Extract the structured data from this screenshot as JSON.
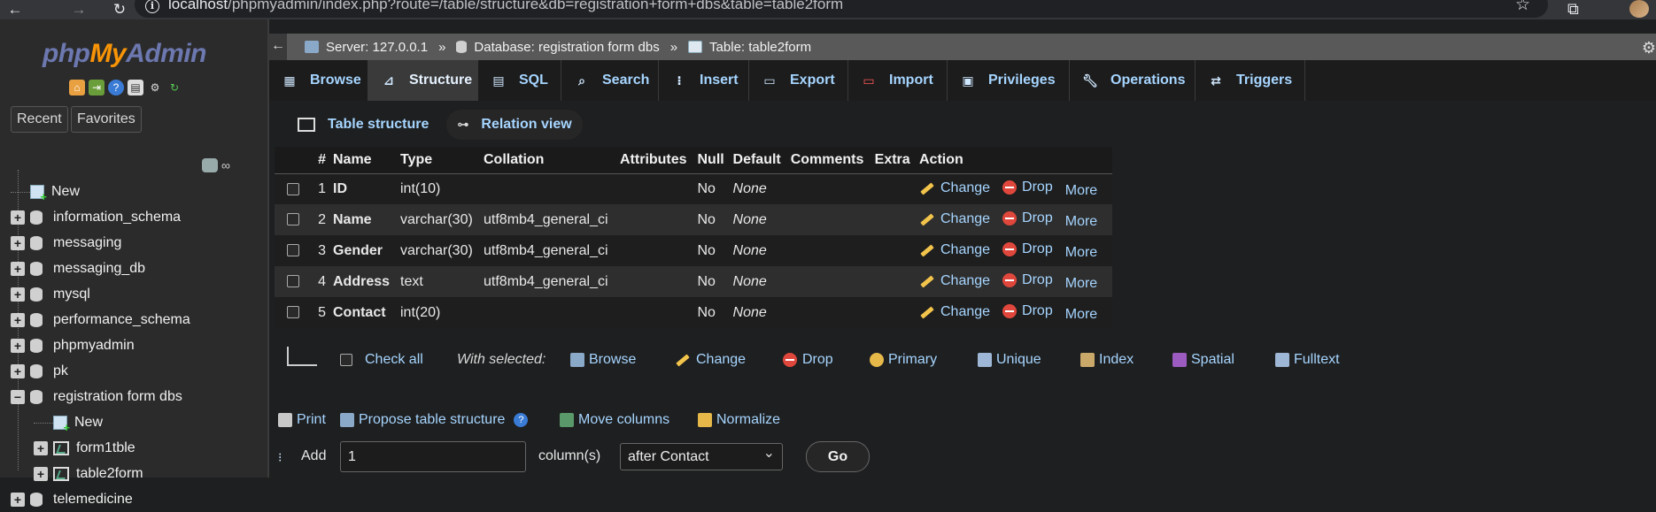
{
  "browser": {
    "url_host": "localhost",
    "url_path": "/phpmyadmin/index.php?route=/table/structure&db=registration+form+dbs&table=table2form"
  },
  "logo": {
    "php": "php",
    "my": "My",
    "admin": "Admin"
  },
  "nav": {
    "recent": "Recent",
    "favorites": "Favorites",
    "tree": [
      {
        "label": "New",
        "kind": "new",
        "level": 0
      },
      {
        "label": "information_schema",
        "kind": "db",
        "level": 0
      },
      {
        "label": "messaging",
        "kind": "db",
        "level": 0
      },
      {
        "label": "messaging_db",
        "kind": "db",
        "level": 0
      },
      {
        "label": "mysql",
        "kind": "db",
        "level": 0
      },
      {
        "label": "performance_schema",
        "kind": "db",
        "level": 0
      },
      {
        "label": "phpmyadmin",
        "kind": "db",
        "level": 0
      },
      {
        "label": "pk",
        "kind": "db",
        "level": 0
      },
      {
        "label": "registration form dbs",
        "kind": "db-open",
        "level": 0
      },
      {
        "label": "New",
        "kind": "new",
        "level": 1
      },
      {
        "label": "form1tble",
        "kind": "table",
        "level": 1
      },
      {
        "label": "table2form",
        "kind": "table",
        "level": 1
      },
      {
        "label": "telemedicine",
        "kind": "db",
        "level": 0
      }
    ]
  },
  "breadcrumb": {
    "server": "Server: 127.0.0.1",
    "database": "Database: registration form dbs",
    "table": "Table: table2form",
    "sep": "»"
  },
  "tabs": [
    "Browse",
    "Structure",
    "SQL",
    "Search",
    "Insert",
    "Export",
    "Import",
    "Privileges",
    "Operations",
    "Triggers"
  ],
  "active_tab": "Structure",
  "subtabs": {
    "table_structure": "Table structure",
    "relation_view": "Relation view"
  },
  "table": {
    "headers": [
      "#",
      "Name",
      "Type",
      "Collation",
      "Attributes",
      "Null",
      "Default",
      "Comments",
      "Extra",
      "Action"
    ],
    "rows": [
      {
        "num": "1",
        "name": "ID",
        "type": "int(10)",
        "collation": "",
        "null": "No",
        "default": "None"
      },
      {
        "num": "2",
        "name": "Name",
        "type": "varchar(30)",
        "collation": "utf8mb4_general_ci",
        "null": "No",
        "default": "None"
      },
      {
        "num": "3",
        "name": "Gender",
        "type": "varchar(30)",
        "collation": "utf8mb4_general_ci",
        "null": "No",
        "default": "None"
      },
      {
        "num": "4",
        "name": "Address",
        "type": "text",
        "collation": "utf8mb4_general_ci",
        "null": "No",
        "default": "None"
      },
      {
        "num": "5",
        "name": "Contact",
        "type": "int(20)",
        "collation": "",
        "null": "No",
        "default": "None"
      }
    ],
    "actions": {
      "change": "Change",
      "drop": "Drop",
      "more": "More"
    }
  },
  "bulk": {
    "check_all": "Check all",
    "with_selected": "With selected:",
    "browse": "Browse",
    "change": "Change",
    "drop": "Drop",
    "primary": "Primary",
    "unique": "Unique",
    "index": "Index",
    "spatial": "Spatial",
    "fulltext": "Fulltext"
  },
  "tools": {
    "print": "Print",
    "propose": "Propose table structure",
    "move_columns": "Move columns",
    "normalize": "Normalize"
  },
  "add": {
    "label": "Add",
    "count": "1",
    "columns_label": "column(s)",
    "position": "after Contact",
    "go": "Go"
  },
  "colors": {
    "link": "#a6d5ff",
    "bg": "#1e1f20",
    "panel": "#2b2b2b"
  }
}
